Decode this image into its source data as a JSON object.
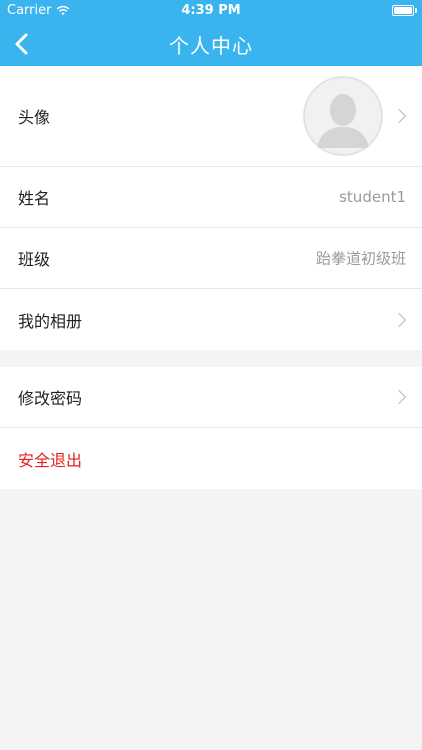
{
  "status_bar": {
    "carrier": "Carrier",
    "time": "4:39 PM"
  },
  "nav": {
    "title": "个人中心",
    "back_icon": "chevron-left-icon"
  },
  "profile_group": {
    "avatar": {
      "label": "头像"
    },
    "name": {
      "label": "姓名",
      "value": "student1"
    },
    "class": {
      "label": "班级",
      "value": "跆拳道初级班"
    },
    "album": {
      "label": "我的相册"
    }
  },
  "account_group": {
    "change_password": {
      "label": "修改密码"
    },
    "logout": {
      "label": "安全退出"
    }
  },
  "colors": {
    "accent": "#3ab4ee",
    "logout_text": "#e52020",
    "background": "#f4f4f4"
  }
}
